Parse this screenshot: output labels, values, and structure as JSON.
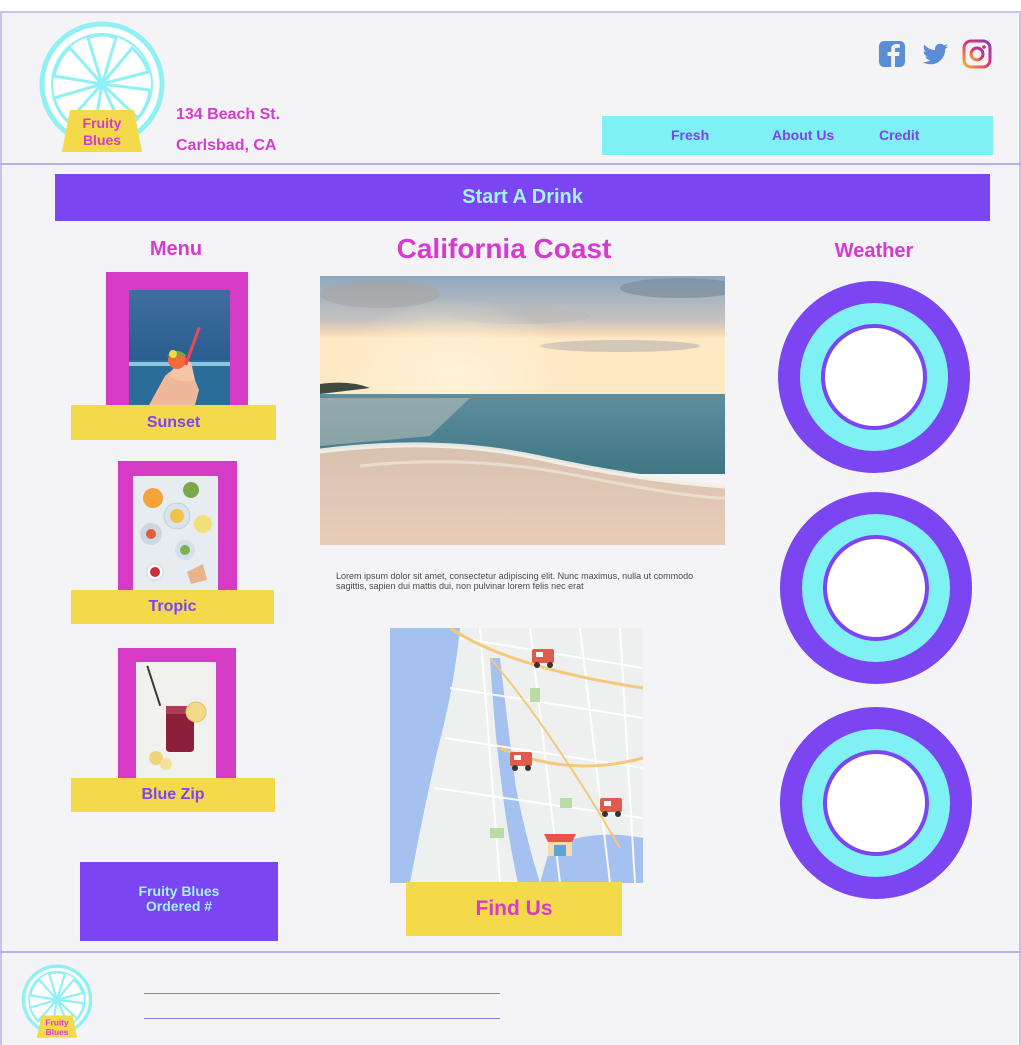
{
  "brand": {
    "logo_line1": "Fruity",
    "logo_line2": "Blues"
  },
  "address": {
    "line1": "134 Beach St.",
    "line2": "Carlsbad, CA"
  },
  "social": [
    "facebook-icon",
    "twitter-icon",
    "instagram-icon"
  ],
  "nav": {
    "items": [
      "Fresh",
      "About Us",
      "Credit"
    ]
  },
  "banner": {
    "label": "Start A Drink"
  },
  "menu": {
    "heading": "Menu",
    "items": [
      {
        "label": "Sunset"
      },
      {
        "label": "Tropic"
      },
      {
        "label": "Blue Zip"
      }
    ]
  },
  "order": {
    "line1": "Fruity Blues",
    "line2": "Ordered     #"
  },
  "hero": {
    "title": "California Coast",
    "body": "Lorem ipsum dolor sit amet, consectetur adipiscing elit. Nunc maximus, nulla ut commodo sagittis, sapien dui mattis dui, non pulvinar lorem felis nec erat"
  },
  "map": {
    "label": "Find Us"
  },
  "weather": {
    "heading": "Weather"
  },
  "colors": {
    "purple": "#7b45f2",
    "magenta": "#d63bd0",
    "cyan": "#7ff0f3",
    "yellow": "#f4d94b",
    "background": "#f4f4f6"
  }
}
